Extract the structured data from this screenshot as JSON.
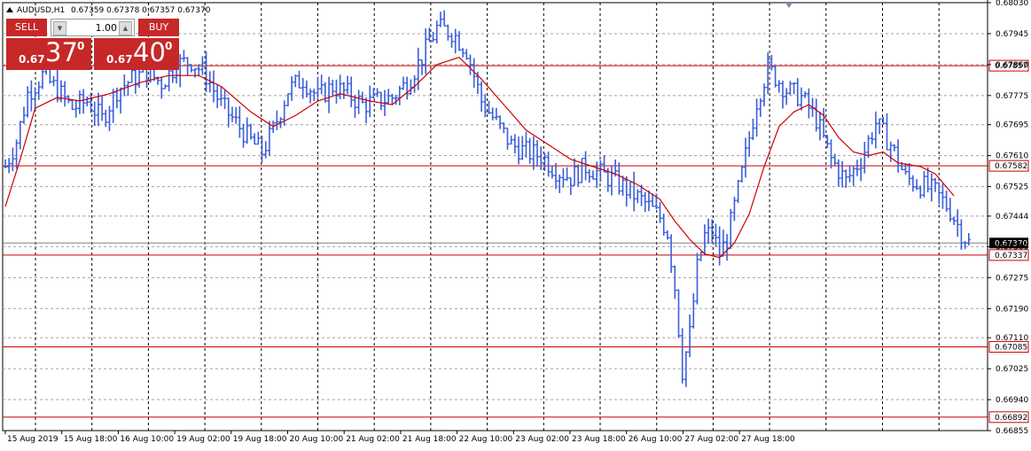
{
  "header": {
    "symbol_label": "AUDUSD,H1",
    "ohlc_text": "0.67359 0.67378 0.67357 0.67370",
    "header_marker_icon": "triangle-up-icon"
  },
  "trade_panel": {
    "sell_label": "SELL",
    "buy_label": "BUY",
    "lot_value": "1.00",
    "spin_down_icon": "arrow-down-icon",
    "spin_up_icon": "arrow-up-icon",
    "sell_small": "0.67",
    "sell_big": "37",
    "sell_sup": "0",
    "buy_small": "0.67",
    "buy_big": "40",
    "buy_sup": "0"
  },
  "colors": {
    "bars": "#3b5fd9",
    "moving_average": "#cc0000",
    "levels": "#cc0000",
    "current_price_line": "#808080",
    "panel": "#c62828"
  },
  "chart_data": {
    "type": "ohlc",
    "symbol": "AUDUSD",
    "timeframe": "H1",
    "ylim": [
      0.66855,
      0.6803
    ],
    "y_ticks": [
      "0.68030",
      "0.67945",
      "0.67860",
      "0.67775",
      "0.67695",
      "0.67610",
      "0.67525",
      "0.67444",
      "0.67360",
      "0.67275",
      "0.67190",
      "0.67110",
      "0.67025",
      "0.66940",
      "0.66855"
    ],
    "x_ticks": [
      "15 Aug 2019",
      "15 Aug 18:00",
      "16 Aug 10:00",
      "19 Aug 02:00",
      "19 Aug 18:00",
      "20 Aug 10:00",
      "21 Aug 02:00",
      "21 Aug 18:00",
      "22 Aug 10:00",
      "23 Aug 02:00",
      "23 Aug 18:00",
      "26 Aug 10:00",
      "27 Aug 02:00",
      "27 Aug 18:00"
    ],
    "grid": true,
    "current_price": "0.67370",
    "levels": [
      {
        "label": "0.67857",
        "value": 0.67857
      },
      {
        "label": "0.67582",
        "value": 0.67582
      },
      {
        "label": "0.67337",
        "value": 0.67337
      },
      {
        "label": "0.67085",
        "value": 0.67085
      },
      {
        "label": "0.66892",
        "value": 0.66892
      }
    ],
    "close_path": [
      [
        0,
        0.6758
      ],
      [
        3,
        0.6765
      ],
      [
        6,
        0.6778
      ],
      [
        10,
        0.6783
      ],
      [
        14,
        0.6779
      ],
      [
        18,
        0.6774
      ],
      [
        22,
        0.6776
      ],
      [
        26,
        0.6771
      ],
      [
        30,
        0.6779
      ],
      [
        34,
        0.6782
      ],
      [
        38,
        0.6784
      ],
      [
        42,
        0.6781
      ],
      [
        46,
        0.6786
      ],
      [
        50,
        0.6787
      ],
      [
        54,
        0.6783
      ],
      [
        58,
        0.6775
      ],
      [
        62,
        0.677
      ],
      [
        66,
        0.6765
      ],
      [
        69,
        0.6762
      ],
      [
        72,
        0.6768
      ],
      [
        76,
        0.6779
      ],
      [
        80,
        0.6782
      ],
      [
        84,
        0.6777
      ],
      [
        88,
        0.678
      ],
      [
        92,
        0.6778
      ],
      [
        96,
        0.6775
      ],
      [
        100,
        0.6776
      ],
      [
        104,
        0.6777
      ],
      [
        108,
        0.6781
      ],
      [
        112,
        0.6788
      ],
      [
        116,
        0.6796
      ],
      [
        120,
        0.6795
      ],
      [
        124,
        0.679
      ],
      [
        128,
        0.6776
      ],
      [
        132,
        0.677
      ],
      [
        136,
        0.6764
      ],
      [
        140,
        0.6762
      ],
      [
        144,
        0.6761
      ],
      [
        148,
        0.6757
      ],
      [
        152,
        0.6755
      ],
      [
        156,
        0.6758
      ],
      [
        160,
        0.6756
      ],
      [
        164,
        0.6754
      ],
      [
        168,
        0.6751
      ],
      [
        172,
        0.6748
      ],
      [
        176,
        0.6744
      ],
      [
        178,
        0.674
      ],
      [
        180,
        0.6725
      ],
      [
        182,
        0.6702
      ],
      [
        184,
        0.6712
      ],
      [
        186,
        0.673
      ],
      [
        188,
        0.6739
      ],
      [
        190,
        0.674
      ],
      [
        192,
        0.6734
      ],
      [
        194,
        0.6738
      ],
      [
        196,
        0.6747
      ],
      [
        198,
        0.6756
      ],
      [
        200,
        0.6766
      ],
      [
        202,
        0.6776
      ],
      [
        205,
        0.6785
      ],
      [
        210,
        0.6779
      ],
      [
        214,
        0.6777
      ],
      [
        218,
        0.6771
      ],
      [
        222,
        0.676
      ],
      [
        226,
        0.6754
      ],
      [
        230,
        0.676
      ],
      [
        234,
        0.677
      ],
      [
        238,
        0.6764
      ],
      [
        242,
        0.6755
      ],
      [
        246,
        0.6753
      ],
      [
        250,
        0.6751
      ],
      [
        254,
        0.6746
      ],
      [
        257,
        0.674
      ],
      [
        259,
        0.6737
      ]
    ],
    "ma_path": [
      [
        0,
        0.6747
      ],
      [
        4,
        0.676
      ],
      [
        8,
        0.6774
      ],
      [
        14,
        0.6777
      ],
      [
        20,
        0.6776
      ],
      [
        28,
        0.6778
      ],
      [
        36,
        0.6781
      ],
      [
        44,
        0.6783
      ],
      [
        52,
        0.6783
      ],
      [
        58,
        0.678
      ],
      [
        66,
        0.6773
      ],
      [
        72,
        0.6769
      ],
      [
        78,
        0.6772
      ],
      [
        84,
        0.6776
      ],
      [
        90,
        0.6778
      ],
      [
        98,
        0.6776
      ],
      [
        104,
        0.6775
      ],
      [
        110,
        0.678
      ],
      [
        116,
        0.6786
      ],
      [
        122,
        0.6788
      ],
      [
        128,
        0.6782
      ],
      [
        134,
        0.6775
      ],
      [
        140,
        0.6768
      ],
      [
        146,
        0.6764
      ],
      [
        152,
        0.676
      ],
      [
        158,
        0.6758
      ],
      [
        164,
        0.6756
      ],
      [
        170,
        0.6753
      ],
      [
        176,
        0.6749
      ],
      [
        180,
        0.6743
      ],
      [
        184,
        0.6738
      ],
      [
        188,
        0.6734
      ],
      [
        192,
        0.6733
      ],
      [
        196,
        0.6737
      ],
      [
        200,
        0.6745
      ],
      [
        204,
        0.6758
      ],
      [
        208,
        0.6769
      ],
      [
        212,
        0.6773
      ],
      [
        216,
        0.6775
      ],
      [
        220,
        0.6772
      ],
      [
        224,
        0.6766
      ],
      [
        228,
        0.6762
      ],
      [
        232,
        0.6761
      ],
      [
        236,
        0.6762
      ],
      [
        240,
        0.6759
      ],
      [
        246,
        0.6758
      ],
      [
        250,
        0.6756
      ],
      [
        255,
        0.675
      ]
    ]
  }
}
